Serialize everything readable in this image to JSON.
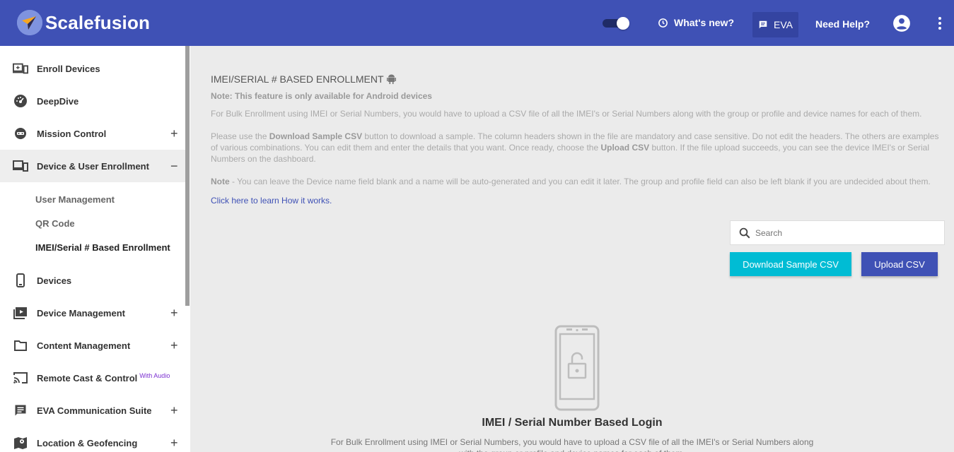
{
  "header": {
    "brand": "Scalefusion",
    "whats_new": "What's new?",
    "eva": "EVA",
    "need_help": "Need Help?"
  },
  "sidebar": {
    "items": [
      {
        "label": "Enroll Devices",
        "icon": "enroll-devices-icon",
        "expandable": false
      },
      {
        "label": "DeepDive",
        "icon": "speedometer-icon",
        "expandable": false
      },
      {
        "label": "Mission Control",
        "icon": "mission-control-icon",
        "expandable": true
      },
      {
        "label": "Device & User Enrollment",
        "icon": "devices-icon",
        "expanded": true
      },
      {
        "label": "Devices",
        "icon": "phone-icon",
        "expandable": false
      },
      {
        "label": "Device Management",
        "icon": "device-management-icon",
        "expandable": true
      },
      {
        "label": "Content Management",
        "icon": "folder-icon",
        "expandable": true
      },
      {
        "label": "Remote Cast & Control",
        "icon": "cast-icon",
        "badge": "With Audio"
      },
      {
        "label": "EVA Communication Suite",
        "icon": "chat-icon",
        "expandable": true
      },
      {
        "label": "Location & Geofencing",
        "icon": "map-icon",
        "expandable": true
      }
    ],
    "sub_items": [
      "User Management",
      "QR Code",
      "IMEI/Serial # Based Enrollment"
    ]
  },
  "main": {
    "title": "IMEI/SERIAL # BASED ENROLLMENT",
    "note": "Note: This feature is only available for Android devices",
    "para1": "For Bulk Enrollment using IMEI or Serial Numbers, you would have to upload a CSV file of all the IMEI's or Serial Numbers along with the group or profile and device names for each of them.",
    "para2_a": "Please use the ",
    "para2_b": "Download Sample CSV",
    "para2_c": " button to download a sample. The column headers shown in the file are mandatory and case sensitive. Do not edit the headers. The others are examples of various combinations. You can edit them and enter the details that you want. Once ready, choose the ",
    "para2_d": "Upload CSV",
    "para2_e": " button. If the file upload succeeds, you can see the device IMEI's or Serial Numbers on the dashboard.",
    "para3_a": "Note",
    "para3_b": " - You can leave the Device name field blank and a name will be auto-generated and you can edit it later. The group and profile field can also be left blank if you are undecided about them.",
    "learn_link": "Click here to learn How it works.",
    "search_placeholder": "Search",
    "download_button": "Download Sample CSV",
    "upload_button": "Upload CSV",
    "empty_title": "IMEI / Serial Number Based Login",
    "empty_desc": "For Bulk Enrollment using IMEI or Serial Numbers, you would have to upload a CSV file of all the IMEI's or Serial Numbers along with the group or profile and device names for each of them."
  },
  "colors": {
    "header": "#3f51b5",
    "accent_cyan": "#00bcd4",
    "link": "#3f51b5",
    "badge_purple": "#7b2fd1"
  }
}
